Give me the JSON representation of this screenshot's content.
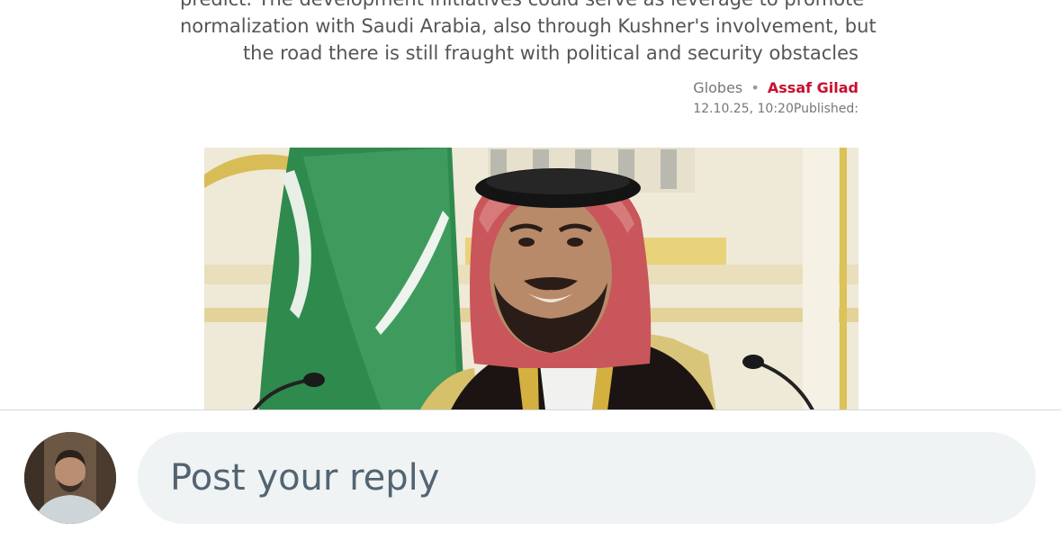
{
  "article": {
    "subtitle_lines": [
      "predict. The development initiatives could serve as leverage to promote",
      "normalization with Saudi Arabia, also through Kushner's involvement, but",
      "the road there is still fraught with political and security obstacles"
    ],
    "source": "Globes",
    "separator": "•",
    "author": "Assaf Gilad",
    "published": "12.10.25, 10:20Published:"
  },
  "reply": {
    "placeholder": "Post your reply"
  },
  "colors": {
    "author_red": "#c8102e",
    "reply_field_bg": "#eff3f4",
    "placeholder_text": "#536471"
  }
}
